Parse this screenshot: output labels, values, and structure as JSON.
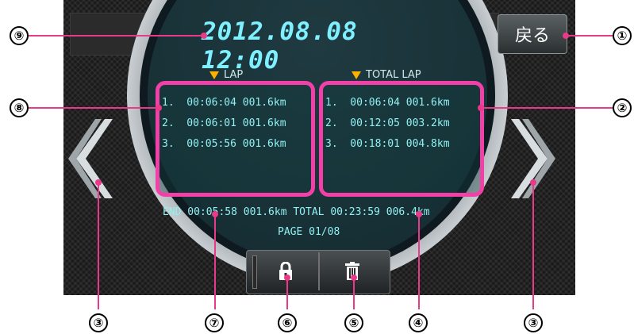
{
  "datetime": "2012.08.08 12:00",
  "back_button": {
    "label": "戻る"
  },
  "lap": {
    "header": "LAP",
    "rows": [
      "1.  00:06:04 001.6km",
      "2.  00:06:01 001.6km",
      "3.  00:05:56 001.6km"
    ]
  },
  "total_lap": {
    "header": "TOTAL LAP",
    "rows": [
      "1.  00:06:04 001.6km",
      "2.  00:12:05 003.2km",
      "3.  00:18:01 004.8km"
    ]
  },
  "end_line": "END 00:05:58 001.6km TOTAL 00:23:59 006.4km",
  "page_line": "PAGE 01/08",
  "buttons": {
    "lock": "lock-icon",
    "trash": "trash-icon"
  },
  "callouts": {
    "c1": "①",
    "c2": "②",
    "c3": "③",
    "c4": "④",
    "c5": "⑤",
    "c6": "⑥",
    "c7": "⑦",
    "c8": "⑧",
    "c9": "⑨"
  },
  "colors": {
    "highlight": "#f33fa8",
    "leader": "#e8398a",
    "text": "#92f0f2",
    "date": "#7ff0ff"
  }
}
